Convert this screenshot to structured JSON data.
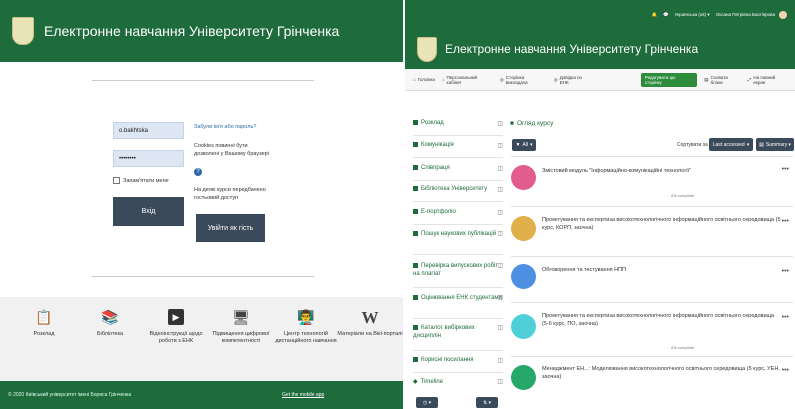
{
  "left": {
    "site_title": "Електронне навчання Університету Грінченка",
    "login": {
      "username_value": "o.bakhtska",
      "password_value": "••••••••",
      "remember_label": "Запам'ятати мене",
      "login_button": "Вхід",
      "forgot_link": "Забули ім'я або пароль?",
      "cookies_text": "Cookies повинні бути дозволені у Вашому браузері",
      "guest_text": "На деякі курси передбачено гостьовий доступ",
      "guest_button": "Увійти як гість"
    },
    "footer_links": [
      {
        "icon": "clipboard-icon",
        "label": "Розклад"
      },
      {
        "icon": "books-icon",
        "label": "Бібліотека"
      },
      {
        "icon": "video-icon",
        "label": "Відеоінструкції щодо роботи з ЕНК"
      },
      {
        "icon": "presentation-icon",
        "label": "Підвищення цифрової компетентності"
      },
      {
        "icon": "teacher-icon",
        "label": "Центр технологій дистанційного навчання"
      },
      {
        "icon": "wikipedia-icon",
        "label": "Матеріали на Вікі-порталі"
      }
    ],
    "copyright": "© 2020 Київський університет імені Бориса Грінченка",
    "mobile_link": "Get the mobile app"
  },
  "right": {
    "topbar": {
      "language": "Українська (uk) ▾",
      "user_name": "Оксана Петрівна Бахтіярова"
    },
    "site_title": "Електронне навчання Університету Грінченка",
    "nav": {
      "home": "Головна",
      "personal": "Персональний кабінет",
      "teacher_page": "Сторінка викладача",
      "ehc_help": "Довідка по ЕНК",
      "edit_button": "Редагувати цю сторінку",
      "hide_blocks": "Сховати блоки",
      "fullscreen": "На повний екран"
    },
    "sidebar": [
      "Розклад",
      "Комунікація",
      "Співпраця",
      "Бібліотека Університету",
      "Е-портфоліо",
      "Пошук наукових публікацій",
      "Перевірка випускових робіт на плагіат",
      "Оцінювання ЕНК студентами",
      "Каталог вибіркових дисциплін",
      "Корисні посилання",
      "Timeline"
    ],
    "overview_title": "Огляд курсу",
    "filter_button": "All",
    "sort_label": "Сортувати за",
    "sort_button": "Last accessed",
    "view_button": "Summary",
    "courses": [
      {
        "title": "Змістовий модуль \"Інформаційно-комунікаційні технології\"",
        "progress": "0% complete",
        "color": "#e35c8e"
      },
      {
        "title": "Проектування та експертиза високотехнологічного інформаційного освітнього середовища (5 курс, КОРП, заочна)",
        "progress": "",
        "color": "#e0b04a"
      },
      {
        "title": "Обговорення та тестування НПП",
        "progress": "",
        "color": "#4d8fe0"
      },
      {
        "title": "Проектування та експертиза високотехнологічного інформаційного освітнього середовища (5-6 курс, ПО, заочна)",
        "progress": "0% complete",
        "color": "#4fd0d8"
      },
      {
        "title": "Менеджмент ЕН...: Моделювання високотехнологічного освітнього середовища (5 курс, УЕН, заочна)",
        "progress": "",
        "color": "#25a86a"
      }
    ]
  }
}
